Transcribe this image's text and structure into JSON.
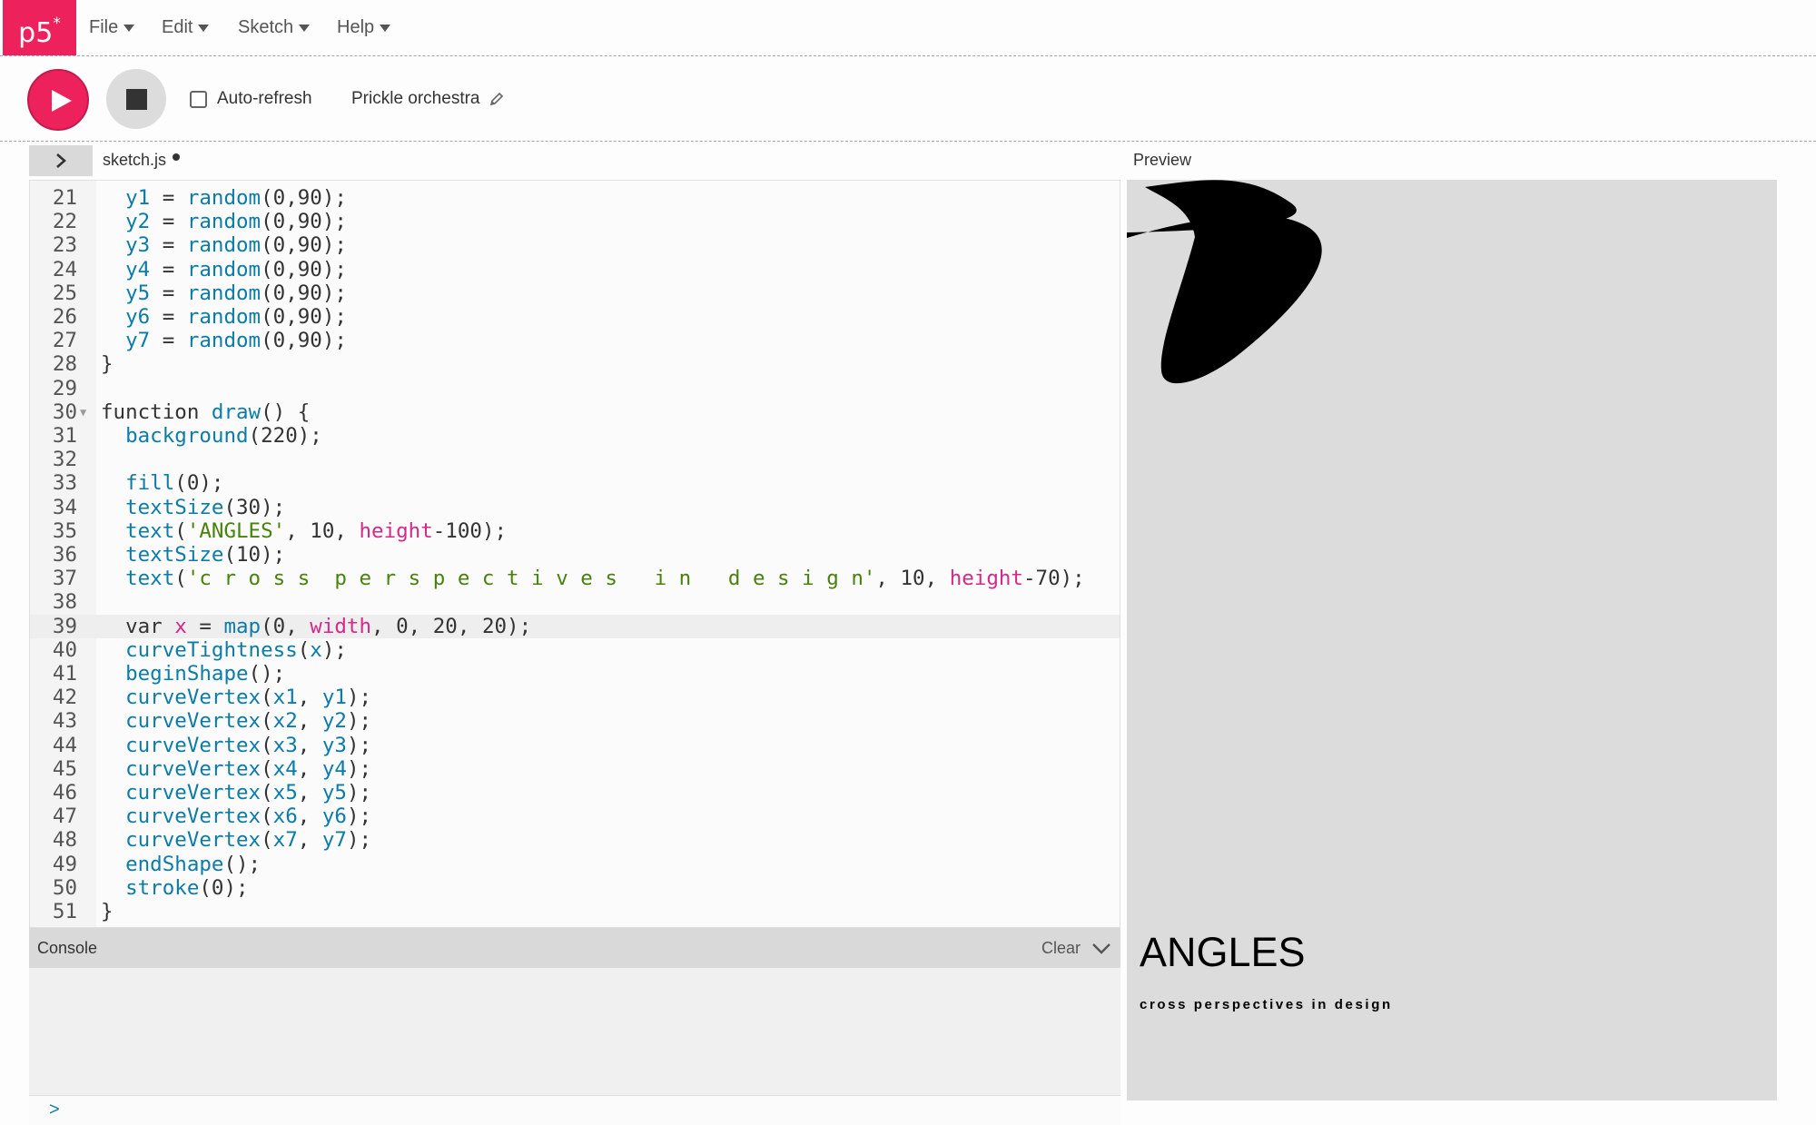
{
  "nav": {
    "logo": "p5",
    "logo_sup": "*",
    "menus": [
      {
        "label": "File"
      },
      {
        "label": "Edit"
      },
      {
        "label": "Sketch"
      },
      {
        "label": "Help"
      }
    ]
  },
  "toolbar": {
    "auto_refresh_label": "Auto-refresh",
    "auto_refresh_checked": false,
    "sketch_name": "Prickle orchestra"
  },
  "editor": {
    "file_name": "sketch.js",
    "unsaved": true,
    "active_line": 39,
    "lines": [
      {
        "n": "21",
        "code": "  y1 = random(0,90);"
      },
      {
        "n": "22",
        "code": "  y2 = random(0,90);"
      },
      {
        "n": "23",
        "code": "  y3 = random(0,90);"
      },
      {
        "n": "24",
        "code": "  y4 = random(0,90);"
      },
      {
        "n": "25",
        "code": "  y5 = random(0,90);"
      },
      {
        "n": "26",
        "code": "  y6 = random(0,90);"
      },
      {
        "n": "27",
        "code": "  y7 = random(0,90);"
      },
      {
        "n": "28",
        "code": "}"
      },
      {
        "n": "29",
        "code": ""
      },
      {
        "n": "30",
        "code": "function draw() {",
        "fold": true
      },
      {
        "n": "31",
        "code": "  background(220);"
      },
      {
        "n": "32",
        "code": ""
      },
      {
        "n": "33",
        "code": "  fill(0);"
      },
      {
        "n": "34",
        "code": "  textSize(30);"
      },
      {
        "n": "35",
        "code": "  text('ANGLES', 10, height-100);"
      },
      {
        "n": "36",
        "code": "  textSize(10);"
      },
      {
        "n": "37",
        "code": "  text('c r o s s  p e r s p e c t i v e s   i n   d e s i g n', 10, height-70);"
      },
      {
        "n": "38",
        "code": ""
      },
      {
        "n": "39",
        "code": "  var x = map(0, width, 0, 20, 20);"
      },
      {
        "n": "40",
        "code": "  curveTightness(x);"
      },
      {
        "n": "41",
        "code": "  beginShape();"
      },
      {
        "n": "42",
        "code": "  curveVertex(x1, y1);"
      },
      {
        "n": "43",
        "code": "  curveVertex(x2, y2);"
      },
      {
        "n": "44",
        "code": "  curveVertex(x3, y3);"
      },
      {
        "n": "45",
        "code": "  curveVertex(x4, y4);"
      },
      {
        "n": "46",
        "code": "  curveVertex(x5, y5);"
      },
      {
        "n": "47",
        "code": "  curveVertex(x6, y6);"
      },
      {
        "n": "48",
        "code": "  curveVertex(x7, y7);"
      },
      {
        "n": "49",
        "code": "  endShape();"
      },
      {
        "n": "50",
        "code": "  stroke(0);"
      },
      {
        "n": "51",
        "code": "}"
      }
    ]
  },
  "console": {
    "title": "Console",
    "clear_label": "Clear",
    "prompt": ">"
  },
  "preview": {
    "label": "Preview",
    "title": "ANGLES",
    "subtitle": "cross perspectives in design"
  },
  "icons": {
    "play": "play-icon",
    "stop": "stop-icon",
    "edit": "pencil-icon",
    "sidebar": "chevron-right-icon",
    "collapse": "chevron-down-icon"
  },
  "colors": {
    "accent": "#ed225d",
    "function": "#0b7ca9",
    "string": "#47820a",
    "builtin_var": "#d52889"
  }
}
